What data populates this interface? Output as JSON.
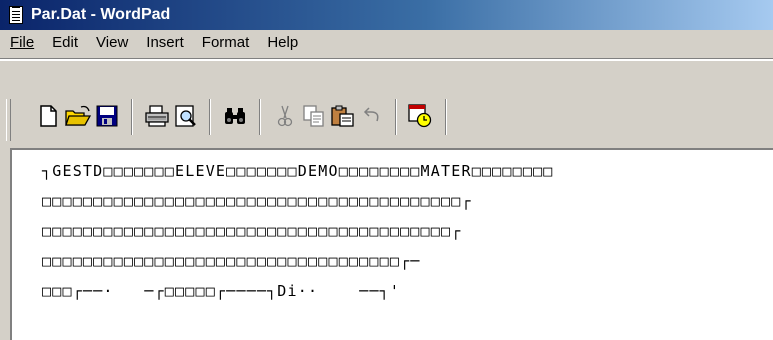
{
  "window": {
    "title": "Par.Dat - WordPad"
  },
  "menu": {
    "items": [
      "File",
      "Edit",
      "View",
      "Insert",
      "Format",
      "Help"
    ]
  },
  "toolbar": {
    "buttons": [
      {
        "name": "new-document",
        "icon": "new-document-icon"
      },
      {
        "name": "open",
        "icon": "open-folder-icon"
      },
      {
        "name": "save",
        "icon": "save-disk-icon"
      },
      {
        "name": "print",
        "icon": "printer-icon"
      },
      {
        "name": "print-preview",
        "icon": "print-preview-icon"
      },
      {
        "name": "find",
        "icon": "binoculars-icon"
      },
      {
        "name": "cut",
        "icon": "scissors-icon"
      },
      {
        "name": "copy",
        "icon": "copy-icon"
      },
      {
        "name": "paste",
        "icon": "paste-icon"
      },
      {
        "name": "undo",
        "icon": "undo-icon"
      },
      {
        "name": "date-time",
        "icon": "date-time-icon"
      }
    ]
  },
  "document": {
    "lines": [
      "┐GESTD□□□□□□□ELEVE□□□□□□□DEMO□□□□□□□□MATER□□□□□□□□",
      "□□□□□□□□□□□□□□□□□□□□□□□□□□□□□□□□□□□□□□□□□┌",
      "□□□□□□□□□□□□□□□□□□□□□□□□□□□□□□□□□□□□□□□□┌",
      "□□□□□□□□□□□□□□□□□□□□□□□□□□□□□□□□□□□┌─",
      "□□□┌──·   ─┌□□□□□┌────┐Di··    ──┐'"
    ]
  }
}
